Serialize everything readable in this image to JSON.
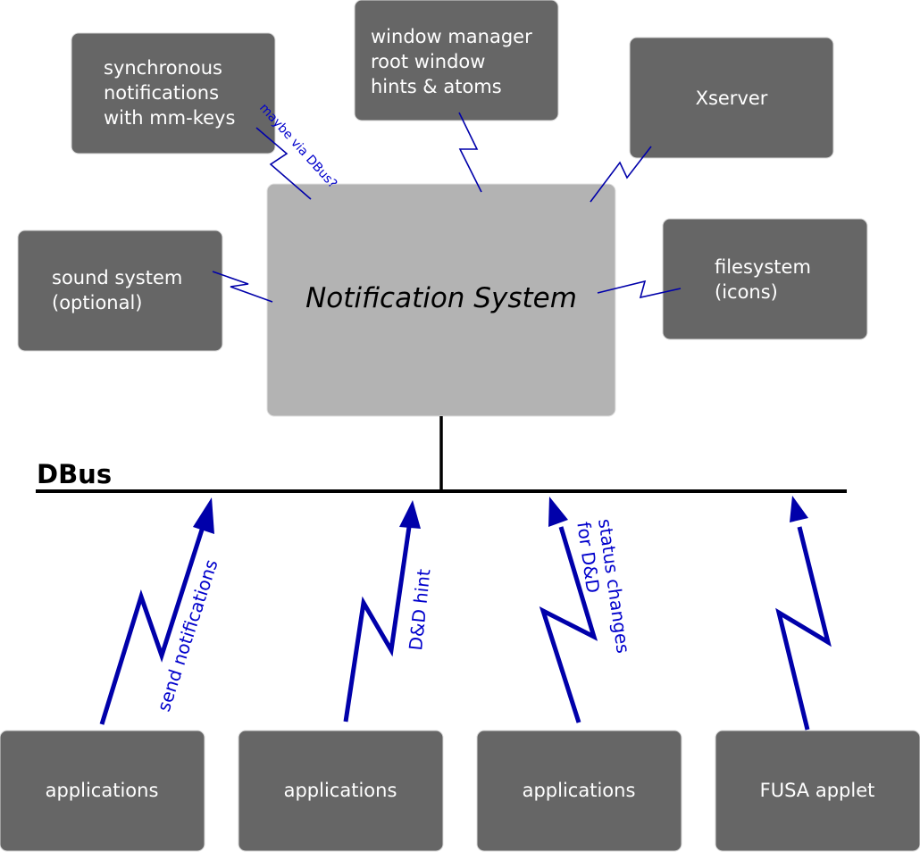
{
  "diagram": {
    "core": {
      "label": "Notification System"
    },
    "bus": {
      "label": "DBus"
    },
    "peripherals": {
      "sync_notifications": [
        "synchronous",
        "notifications",
        "with mm-keys"
      ],
      "window_manager": [
        "window manager",
        "root window",
        "hints & atoms"
      ],
      "xserver": [
        "Xserver"
      ],
      "sound_system": [
        "sound system",
        "(optional)"
      ],
      "filesystem": [
        "filesystem",
        "(icons)"
      ]
    },
    "side_link_labels": {
      "sync_link": "maybe via DBus?"
    },
    "clients": [
      {
        "label": "applications",
        "arrow_label": [
          "send notifications"
        ]
      },
      {
        "label": "applications",
        "arrow_label": [
          "D&D hint"
        ]
      },
      {
        "label": "applications",
        "arrow_label": [
          "status changes",
          "for D&D"
        ]
      },
      {
        "label": "FUSA applet",
        "arrow_label": []
      }
    ],
    "colors": {
      "box_dark": "#666666",
      "box_core": "#b3b3b3",
      "link_blue": "#0000aa",
      "label_blue": "#0000cc",
      "bus_black": "#000000"
    }
  }
}
